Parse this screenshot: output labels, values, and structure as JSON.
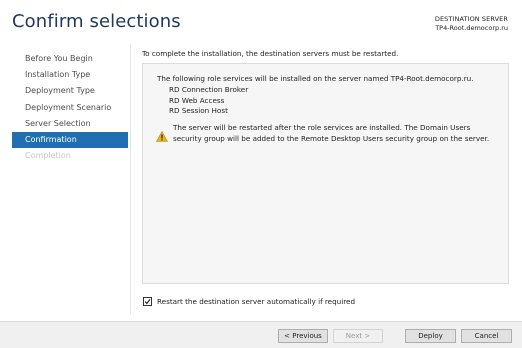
{
  "header": {
    "title": "Confirm selections",
    "destination_label": "DESTINATION SERVER",
    "destination_value": "TP4-Root.democorp.ru"
  },
  "sidebar": {
    "items": [
      {
        "label": "Before You Begin",
        "state": "normal"
      },
      {
        "label": "Installation Type",
        "state": "normal"
      },
      {
        "label": "Deployment Type",
        "state": "normal"
      },
      {
        "label": "Deployment Scenario",
        "state": "normal"
      },
      {
        "label": "Server Selection",
        "state": "normal"
      },
      {
        "label": "Confirmation",
        "state": "active"
      },
      {
        "label": "Completion",
        "state": "disabled"
      }
    ]
  },
  "main": {
    "intro": "To complete the installation, the destination servers must be restarted.",
    "box_intro": "The following role services will be installed on the server named TP4-Root.democorp.ru.",
    "roles": [
      "RD Connection Broker",
      "RD Web Access",
      "RD Session Host"
    ],
    "warning": "The server will be restarted after the role services are installed. The Domain Users security group will be added to the Remote Desktop Users security group on the server.",
    "restart_label": "Restart the destination server automatically if required",
    "restart_checked": true
  },
  "footer": {
    "previous": "< Previous",
    "next": "Next >",
    "deploy": "Deploy",
    "cancel": "Cancel"
  },
  "colors": {
    "title": "#1e395b",
    "active_nav": "#1f6fb2",
    "warning_icon": "#e8b31a"
  }
}
